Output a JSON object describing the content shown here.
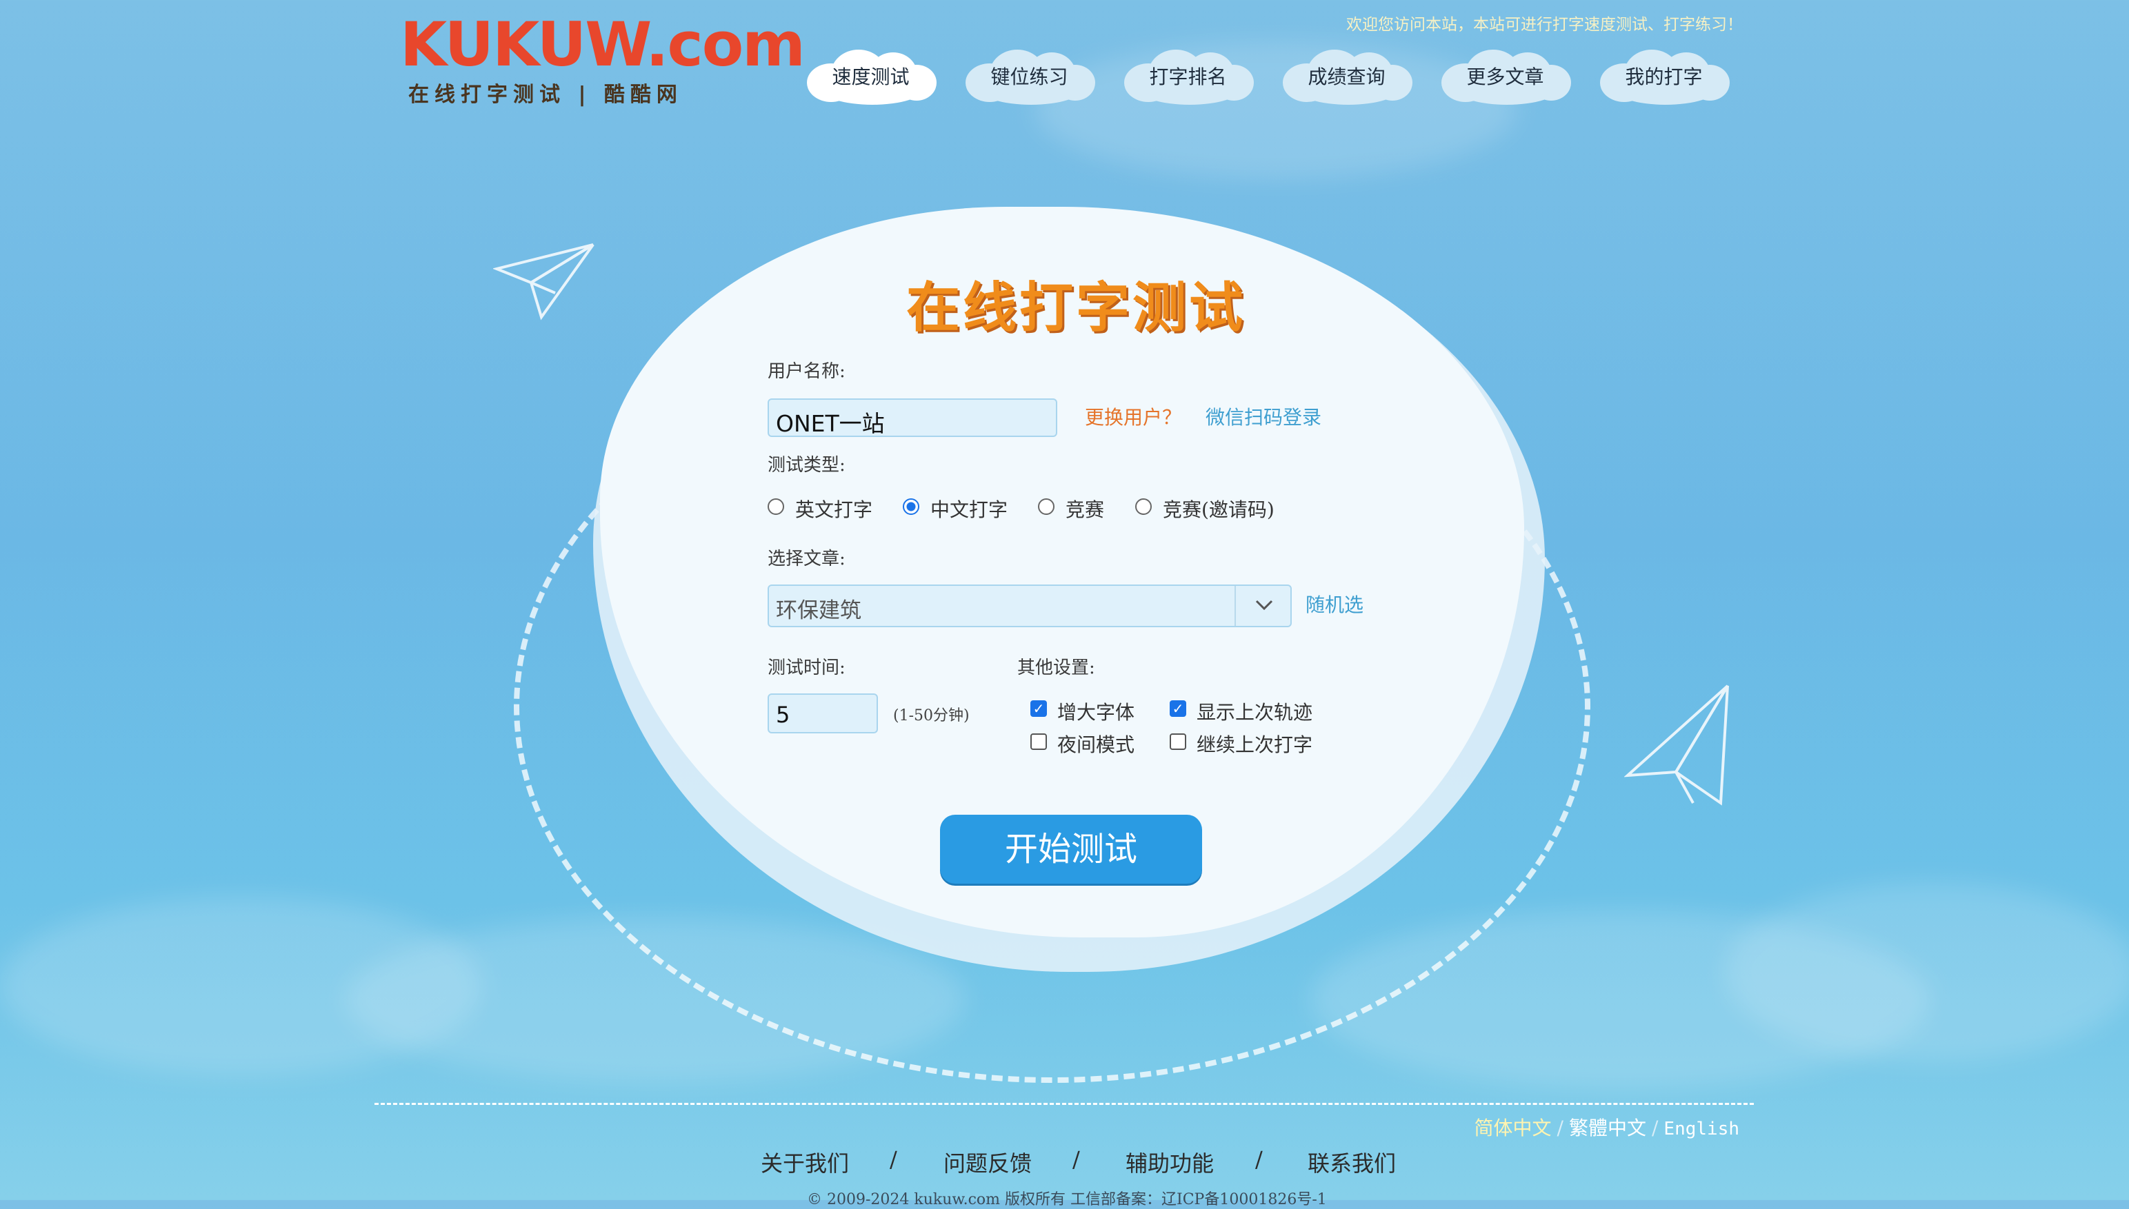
{
  "header": {
    "logo_text": "KUKUW.com",
    "logo_subtitle": "在线打字测试 | 酷酷网",
    "welcome": "欢迎您访问本站，本站可进行打字速度测试、打字练习！"
  },
  "nav": {
    "items": [
      {
        "label": "速度测试",
        "active": true
      },
      {
        "label": "键位练习",
        "active": false
      },
      {
        "label": "打字排名",
        "active": false
      },
      {
        "label": "成绩查询",
        "active": false
      },
      {
        "label": "更多文章",
        "active": false
      },
      {
        "label": "我的打字",
        "active": false
      }
    ]
  },
  "form": {
    "title": "在线打字测试",
    "username_label": "用户名称:",
    "username_value": "ONET一站",
    "change_user": "更换用户？",
    "wechat_login": "微信扫码登录",
    "test_type_label": "测试类型:",
    "test_types": [
      {
        "label": "英文打字",
        "checked": false
      },
      {
        "label": "中文打字",
        "checked": true
      },
      {
        "label": "竞赛",
        "checked": false
      },
      {
        "label": "竞赛(邀请码)",
        "checked": false
      }
    ],
    "article_label": "选择文章:",
    "article_value": "环保建筑",
    "random_pick": "随机选",
    "time_label": "测试时间:",
    "time_value": "5",
    "time_hint": "(1-50分钟)",
    "other_label": "其他设置:",
    "options": [
      {
        "label": "增大字体",
        "checked": true
      },
      {
        "label": "显示上次轨迹",
        "checked": true
      },
      {
        "label": "夜间模式",
        "checked": false
      },
      {
        "label": "继续上次打字",
        "checked": false
      }
    ],
    "start_button": "开始测试"
  },
  "footer": {
    "languages": [
      "简体中文",
      "繁體中文",
      "English"
    ],
    "lang_sep": "/",
    "links": [
      "关于我们",
      "问题反馈",
      "辅助功能",
      "联系我们"
    ],
    "link_sep": "/",
    "copyright": "© 2009-2024 kukuw.com 版权所有 工信部备案：辽ICP备10001826号-1"
  },
  "colors": {
    "accent": "#2a9be3",
    "title_orange": "#f08c1b",
    "link_orange": "#e5742a",
    "link_blue": "#3f9fd0"
  }
}
